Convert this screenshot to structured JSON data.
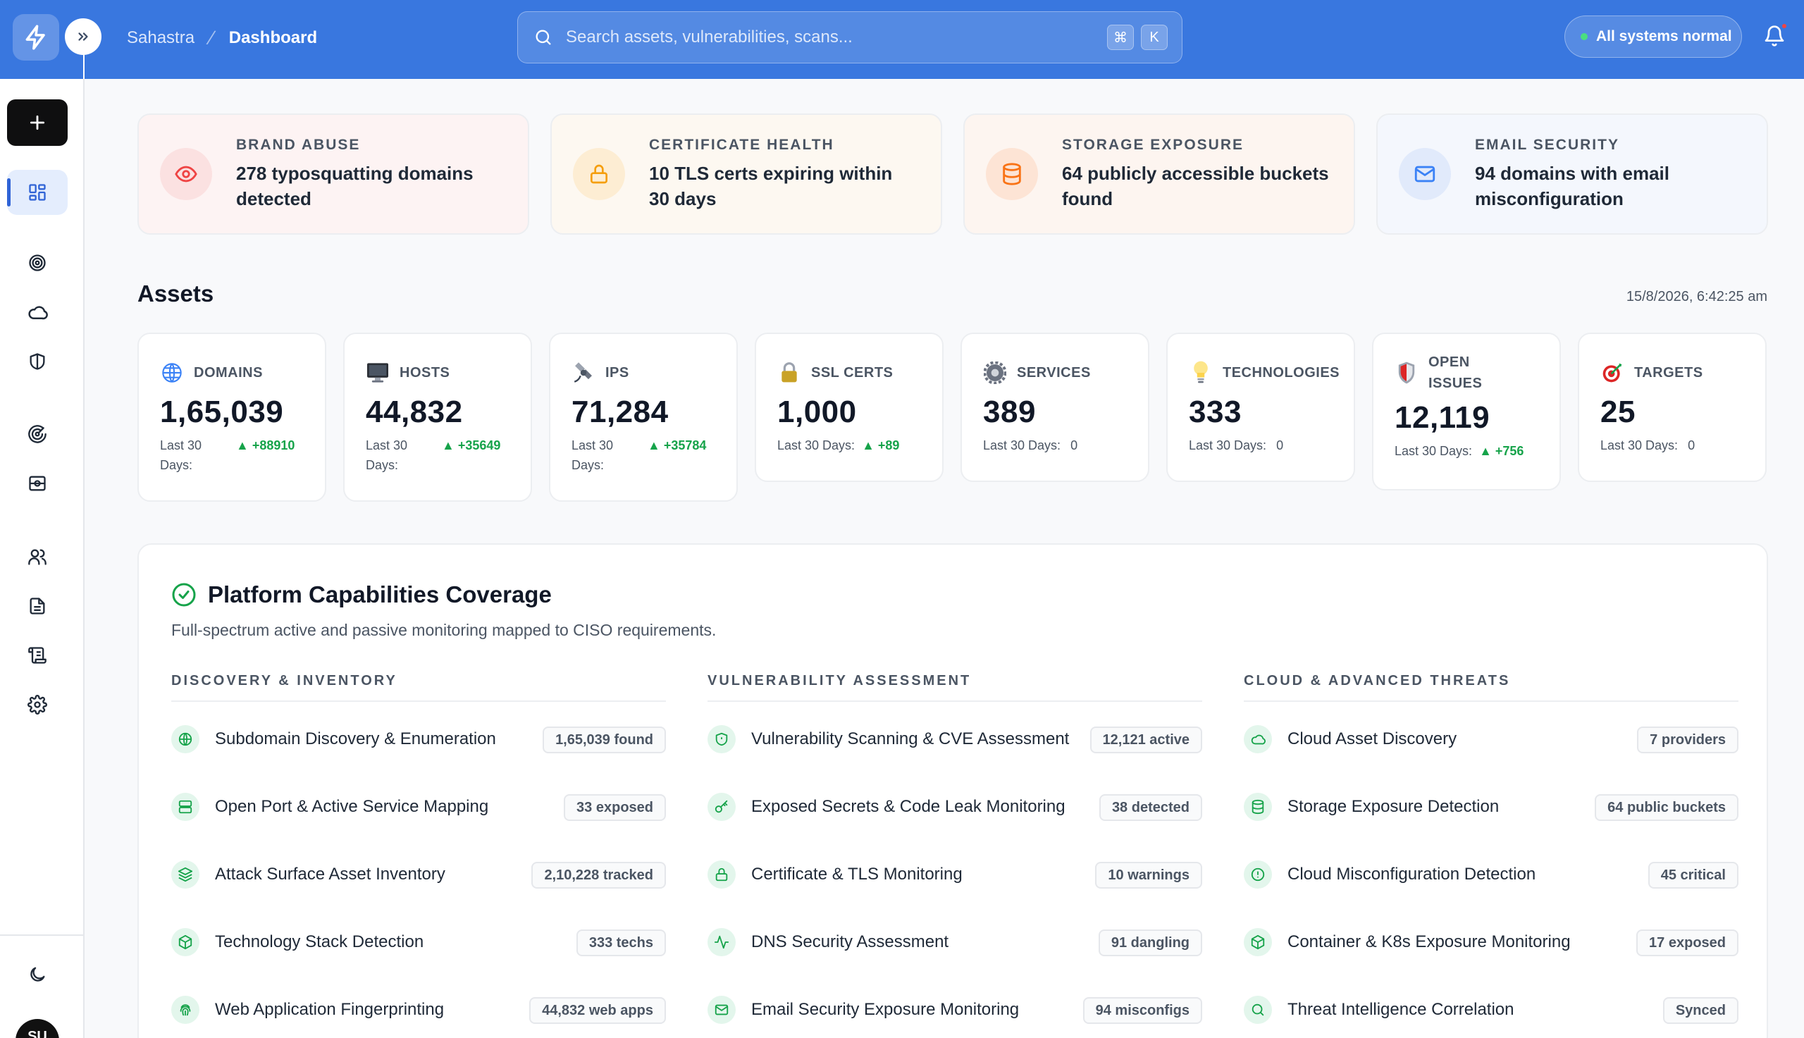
{
  "topbar": {
    "breadcrumb": [
      "Sahastra",
      "Dashboard"
    ],
    "search_placeholder": "Search assets, vulnerabilities, scans...",
    "shortcut_keys": [
      "⌘",
      "K"
    ],
    "status_label": "All systems normal"
  },
  "sidebar": {
    "user_initials": "SU",
    "items": [
      "new-scan",
      "dashboard",
      "targets",
      "cloud",
      "security",
      "attack-surface",
      "scans",
      "users",
      "reports",
      "logs",
      "settings",
      "theme-toggle"
    ]
  },
  "alerts": [
    {
      "label": "BRAND ABUSE",
      "message": "278 typosquatting domains detected",
      "icon": "eye-icon",
      "color": "#ef4444",
      "bg": "#fdf3f3"
    },
    {
      "label": "CERTIFICATE HEALTH",
      "message": "10 TLS certs expiring within 30 days",
      "icon": "lock-icon",
      "color": "#f59e0b",
      "bg": "#fdf8f1"
    },
    {
      "label": "STORAGE EXPOSURE",
      "message": "64 publicly accessible buckets found",
      "icon": "database-icon",
      "color": "#f97316",
      "bg": "#fdf5f0"
    },
    {
      "label": "EMAIL SECURITY",
      "message": "94 domains with email misconfiguration",
      "icon": "mail-icon",
      "color": "#3b82f6",
      "bg": "#f4f7fd"
    }
  ],
  "assets": {
    "title": "Assets",
    "timestamp": "15/8/2026, 6:42:25 am",
    "trend_label": "Last 30 Days:",
    "cards": [
      {
        "name": "DOMAINS",
        "value": "1,65,039",
        "delta": "▲ +88910",
        "icon": "globe-icon"
      },
      {
        "name": "HOSTS",
        "value": "44,832",
        "delta": "▲ +35649",
        "icon": "monitor-icon"
      },
      {
        "name": "IPS",
        "value": "71,284",
        "delta": "▲ +35784",
        "icon": "satellite-icon"
      },
      {
        "name": "SSL CERTS",
        "value": "1,000",
        "delta": "▲ +89",
        "icon": "padlock-icon"
      },
      {
        "name": "SERVICES",
        "value": "389",
        "delta": "0",
        "icon": "gear-icon"
      },
      {
        "name": "TECHNOLOGIES",
        "value": "333",
        "delta": "0",
        "icon": "lightbulb-icon"
      },
      {
        "name": "OPEN ISSUES",
        "value": "12,119",
        "delta": "▲ +756",
        "icon": "shield-icon"
      },
      {
        "name": "TARGETS",
        "value": "25",
        "delta": "0",
        "icon": "dart-target-icon"
      }
    ]
  },
  "coverage": {
    "title": "Platform Capabilities Coverage",
    "subtitle": "Full-spectrum active and passive monitoring mapped to CISO requirements.",
    "columns": [
      {
        "heading": "DISCOVERY & INVENTORY",
        "rows": [
          {
            "label": "Subdomain Discovery & Enumeration",
            "badge": "1,65,039 found",
            "icon": "globe-icon"
          },
          {
            "label": "Open Port & Active Service Mapping",
            "badge": "33 exposed",
            "icon": "server-icon"
          },
          {
            "label": "Attack Surface Asset Inventory",
            "badge": "2,10,228 tracked",
            "icon": "layers-icon"
          },
          {
            "label": "Technology Stack Detection",
            "badge": "333 techs",
            "icon": "cube-icon"
          },
          {
            "label": "Web Application Fingerprinting",
            "badge": "44,832 web apps",
            "icon": "fingerprint-icon"
          }
        ]
      },
      {
        "heading": "VULNERABILITY ASSESSMENT",
        "rows": [
          {
            "label": "Vulnerability Scanning & CVE Assessment",
            "badge": "12,121 active",
            "icon": "shield-icon"
          },
          {
            "label": "Exposed Secrets & Code Leak Monitoring",
            "badge": "38 detected",
            "icon": "key-icon"
          },
          {
            "label": "Certificate & TLS Monitoring",
            "badge": "10 warnings",
            "icon": "lock-icon"
          },
          {
            "label": "DNS Security Assessment",
            "badge": "91 dangling",
            "icon": "activity-icon"
          },
          {
            "label": "Email Security Exposure Monitoring",
            "badge": "94 misconfigs",
            "icon": "mail-icon"
          }
        ]
      },
      {
        "heading": "CLOUD & ADVANCED THREATS",
        "rows": [
          {
            "label": "Cloud Asset Discovery",
            "badge": "7 providers",
            "icon": "cloud-icon"
          },
          {
            "label": "Storage Exposure Detection",
            "badge": "64 public buckets",
            "icon": "database-icon"
          },
          {
            "label": "Cloud Misconfiguration Detection",
            "badge": "45 critical",
            "icon": "alert-circle-icon"
          },
          {
            "label": "Container & K8s Exposure Monitoring",
            "badge": "17 exposed",
            "icon": "cube-icon"
          },
          {
            "label": "Threat Intelligence Correlation",
            "badge": "Synced",
            "icon": "search-icon"
          }
        ]
      }
    ]
  }
}
